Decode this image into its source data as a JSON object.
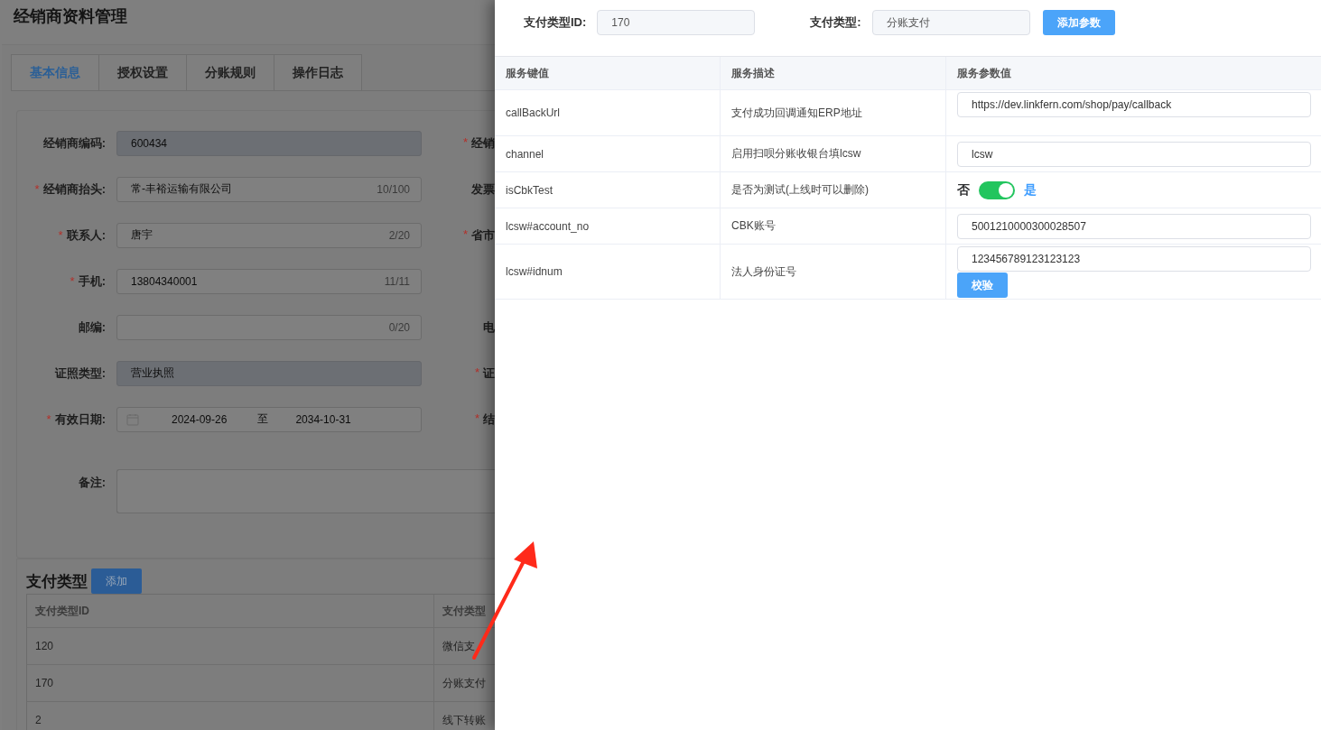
{
  "page": {
    "title": "经销商资料管理",
    "tabs": [
      {
        "label": "基本信息",
        "selected": true
      },
      {
        "label": "授权设置",
        "selected": false
      },
      {
        "label": "分账规则",
        "selected": false
      },
      {
        "label": "操作日志",
        "selected": false
      }
    ],
    "form_rows": [
      {
        "label": "经销商编码:",
        "kind": "input",
        "value": "600434",
        "disabled": true,
        "right_label": {
          "text": "经销",
          "asterisk": "*"
        }
      },
      {
        "label": "经销商抬头:",
        "asterisk": "*",
        "kind": "input",
        "value": "常-丰裕运输有限公司",
        "counter": "10/100",
        "disabled": false,
        "right_label": {
          "text": "发票"
        }
      },
      {
        "label": "联系人:",
        "asterisk": "*",
        "kind": "input",
        "value": "唐宇",
        "counter": "2/20",
        "disabled": false,
        "right_label": {
          "text": "省市",
          "asterisk": "*"
        }
      },
      {
        "label": "手机:",
        "asterisk": "*",
        "kind": "input",
        "value": "13804340001",
        "counter": "11/11",
        "disabled": false
      },
      {
        "label": "邮编:",
        "kind": "input",
        "counter": "0/20",
        "disabled": false,
        "right_label": {
          "text": "电"
        }
      },
      {
        "label": "证照类型:",
        "kind": "input",
        "value": "营业执照",
        "disabled": true,
        "right_label": {
          "text": "证",
          "asterisk": "*"
        }
      },
      {
        "label": "有效日期:",
        "asterisk": "*",
        "kind": "daterange",
        "start": "2024-09-26",
        "separator": "至",
        "end": "2034-10-31",
        "disabled": false,
        "right_label": {
          "text": "结",
          "asterisk": "*"
        }
      },
      {
        "label": "备注:",
        "kind": "textarea",
        "disabled": false
      }
    ],
    "payment_section": {
      "title": "支付类型",
      "add_button": "添加",
      "columns": [
        "支付类型ID",
        "支付类型"
      ],
      "rows": [
        [
          "120",
          "微信支"
        ],
        [
          "170",
          "分账支付"
        ],
        [
          "2",
          "线下转账"
        ]
      ]
    }
  },
  "drawer": {
    "id_label": "支付类型ID:",
    "id_value": "170",
    "type_label": "支付类型:",
    "type_value": "分账支付",
    "add_button": "添加参数",
    "columns": [
      "服务键值",
      "服务描述",
      "服务参数值"
    ],
    "rows": [
      {
        "key": "callBackUrl",
        "description": "支付成功回调通知ERP地址",
        "kind": "input",
        "value": "https://dev.linkfern.com/shop/pay/callback"
      },
      {
        "key": "channel",
        "description": "启用扫呗分账收银台填lcsw",
        "kind": "input",
        "value": "lcsw"
      },
      {
        "key": "isCbkTest",
        "description": "是否为测试(上线时可以删除)",
        "kind": "switch",
        "off_label": "否",
        "on_label": "是",
        "on": true
      },
      {
        "key": "lcsw#account_no",
        "description": "CBK账号",
        "kind": "input",
        "value": "5001210000300028507"
      },
      {
        "key": "lcsw#idnum",
        "description": "法人身份证号",
        "kind": "input_button",
        "value": "123456789123123123",
        "button": "校验"
      }
    ]
  }
}
